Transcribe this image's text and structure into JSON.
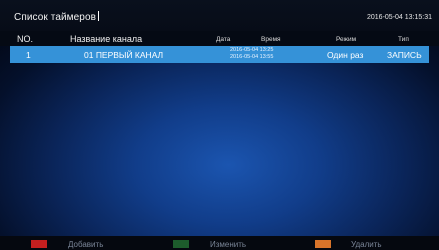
{
  "header": {
    "title": "Список таймеров",
    "clock": "2016-05-04 13:15:31"
  },
  "columns": {
    "no": "NO.",
    "channel": "Название канала",
    "date": "Дата",
    "time": "Время",
    "mode": "Режим",
    "type": "Тип"
  },
  "timers": [
    {
      "no": "1",
      "channel": "01 ПЕРВЫЙ КАНАЛ",
      "start": "2016-05-04 13:25",
      "end": "2016-05-04 13:55",
      "mode": "Один раз",
      "type": "ЗАПИСЬ"
    }
  ],
  "footer": {
    "add": {
      "label": "Добавить",
      "color": "#c41f1f"
    },
    "edit": {
      "label": "Изменить",
      "color": "#1d5c2c"
    },
    "delete": {
      "label": "Удалить",
      "color": "#d8742a"
    }
  },
  "colors": {
    "selection": "#3592d8",
    "background": "#0e357a"
  }
}
